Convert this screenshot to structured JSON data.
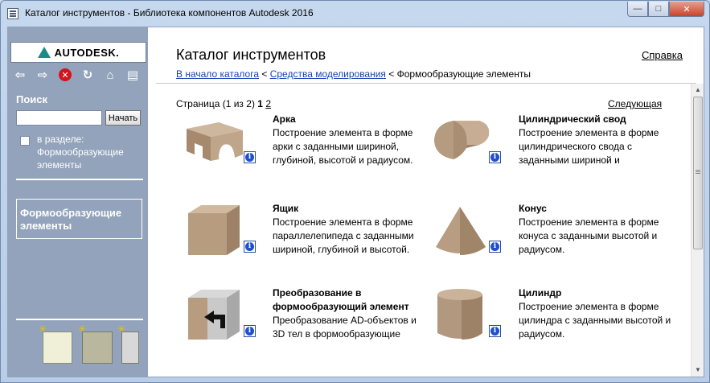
{
  "window": {
    "title": "Каталог инструментов - Библиотека компонентов Autodesk 2016",
    "buttons": {
      "minimize": "—",
      "maximize": "□",
      "close": "✕"
    }
  },
  "sidebar": {
    "logo_text": "AUTODESK.",
    "nav_icons": [
      "back-arrow-icon",
      "forward-arrow-icon",
      "stop-icon",
      "refresh-icon",
      "home-icon",
      "print-icon"
    ],
    "search_label": "Поиск",
    "search_value": "",
    "search_button": "Начать",
    "in_section_label": "в разделе: Формообразующие элементы",
    "current_category": "Формообразующие элементы"
  },
  "main": {
    "title": "Каталог инструментов",
    "help_link": "Справка",
    "breadcrumb": {
      "home": "В начало каталога",
      "sep1": " < ",
      "modeling": "Средства моделирования",
      "sep2": " < ",
      "current": "Формообразующие элементы"
    },
    "pager": {
      "prefix": "Страница (1 из 2) ",
      "current": "1",
      "page2": "2",
      "next": "Следующая"
    },
    "items": [
      {
        "title": "Арка",
        "desc": "Построение элемента в форме арки с заданными шириной, глубиной, высотой и радиусом."
      },
      {
        "title": "Цилиндрический свод",
        "desc": "Построение элемента в форме цилиндрического свода с заданными шириной и"
      },
      {
        "title": "Ящик",
        "desc": "Построение элемента в форме параллелепипеда с заданными шириной, глубиной и высотой."
      },
      {
        "title": "Конус",
        "desc": "Построение элемента в форме конуса с заданными высотой и радиусом."
      },
      {
        "title": "Преобразование в формообразующий элемент",
        "desc": "Преобразование AD-объектов и 3D тел в формообразующие"
      },
      {
        "title": "Цилиндр",
        "desc": "Построение элемента в форме цилиндра с заданными высотой и радиусом."
      }
    ]
  },
  "colors": {
    "sidebar_bg": "#93a3bb",
    "link": "#1a3fb5",
    "shape": "#b59c82"
  }
}
